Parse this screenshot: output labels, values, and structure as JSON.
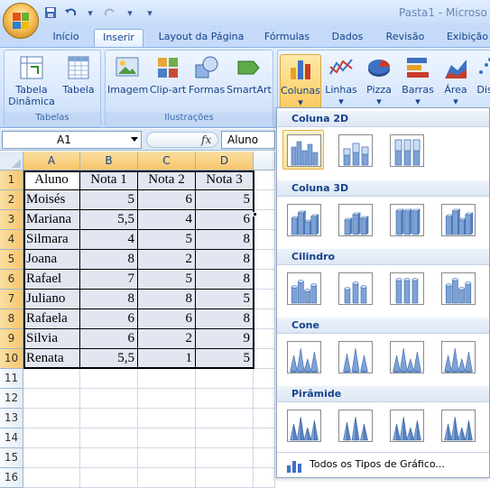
{
  "window": {
    "title": "Pasta1 - Microso"
  },
  "ribbon": {
    "tabs": [
      "Início",
      "Inserir",
      "Layout da Página",
      "Fórmulas",
      "Dados",
      "Revisão",
      "Exibição"
    ],
    "active_tab": "Inserir",
    "groups": {
      "tabelas": {
        "label": "Tabelas",
        "buttons": [
          "Tabela\nDinâmica",
          "Tabela"
        ]
      },
      "ilustracoes": {
        "label": "Ilustrações",
        "buttons": [
          "Imagem",
          "Clip-art",
          "Formas",
          "SmartArt"
        ]
      },
      "graficos": {
        "buttons": [
          "Colunas",
          "Linhas",
          "Pizza",
          "Barras",
          "Área",
          "Dis"
        ]
      }
    },
    "btn": {
      "tabela_dinamica_1": "Tabela",
      "tabela_dinamica_2": "Dinâmica",
      "tabela": "Tabela",
      "imagem": "Imagem",
      "clipart": "Clip-art",
      "formas": "Formas",
      "smartart": "SmartArt",
      "colunas": "Colunas",
      "linhas": "Linhas",
      "pizza": "Pizza",
      "barras": "Barras",
      "area": "Área",
      "dis": "Dis"
    }
  },
  "formula_bar": {
    "name_box": "A1",
    "fx": "fx",
    "content": "Aluno"
  },
  "sheet": {
    "columns": [
      "A",
      "B",
      "C",
      "D"
    ],
    "rows": [
      "1",
      "2",
      "3",
      "4",
      "5",
      "6",
      "7",
      "8",
      "9",
      "10",
      "11",
      "12",
      "13",
      "14",
      "15",
      "16"
    ],
    "header": [
      "Aluno",
      "Nota 1",
      "Nota 2",
      "Nota 3"
    ],
    "data": [
      [
        "Moisés",
        "5",
        "6",
        "5"
      ],
      [
        "Mariana",
        "5,5",
        "4",
        "6"
      ],
      [
        "Silmara",
        "4",
        "5",
        "8"
      ],
      [
        "Joana",
        "8",
        "2",
        "8"
      ],
      [
        "Rafael",
        "7",
        "5",
        "8"
      ],
      [
        "Juliano",
        "8",
        "8",
        "5"
      ],
      [
        "Rafaela",
        "6",
        "6",
        "8"
      ],
      [
        "Silvia",
        "6",
        "2",
        "9"
      ],
      [
        "Renata",
        "5,5",
        "1",
        "5"
      ]
    ]
  },
  "gallery": {
    "sections": [
      "Coluna 2D",
      "Coluna 3D",
      "Cilindro",
      "Cone",
      "Pirâmide"
    ],
    "all_types": "Todos os Tipos de Gráfico..."
  },
  "colors": {
    "accent": "#fbc85b",
    "ribbon": "#d2e3fb",
    "selection": "#e1e6f1"
  }
}
